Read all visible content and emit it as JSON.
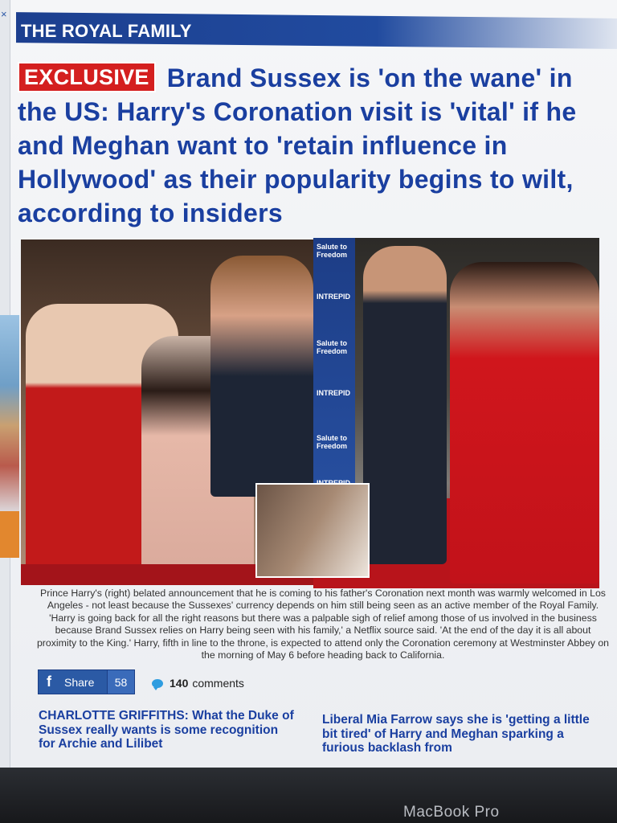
{
  "section": {
    "title": "THE ROYAL FAMILY"
  },
  "article": {
    "badge": "EXCLUSIVE",
    "headline": "Brand Sussex is 'on the wane' in the US: Harry's Coronation visit is 'vital' if he and Meghan want to 'retain influence in Hollywood' as their popularity begins to wilt, according to insiders",
    "caption": "Prince Harry's (right) belated announcement that he is coming to his father's Coronation next month was warmly welcomed in Los Angeles - not least because the Sussexes' currency depends on him still being seen as an active member of the Royal Family. 'Harry is going back for all the right reasons but there was a palpable sigh of relief among those of us involved in the business because Brand Sussex relies on Harry being seen with his family,' a Netflix source said. 'At the end of the day it is all about proximity to the King.' Harry, fifth in line to the throne, is expected to attend only the Coronation ceremony at Westminster Abbey on the morning of May 6 before heading back to California."
  },
  "photo": {
    "banner_words": [
      "Salute to Freedom",
      "INTREPID",
      "Salute to Freedom",
      "INTREPID",
      "Salute to Freedom",
      "INTREPID"
    ]
  },
  "social": {
    "share_label": "Share",
    "share_count": "58",
    "comment_count": "140",
    "comment_label": "comments"
  },
  "related": [
    {
      "title": "CHARLOTTE GRIFFITHS: What the Duke of Sussex really wants is some recognition for Archie and Lilibet"
    },
    {
      "title": "Liberal Mia Farrow says she is 'getting a little bit tired' of Harry and Meghan sparking a furious backlash from"
    }
  ],
  "device": {
    "brand": "MacBook Pro"
  },
  "colors": {
    "headline_blue": "#1a3fa0",
    "exclusive_red": "#d41f1f",
    "section_bar": "#1c3f8f",
    "facebook_blue": "#2b5aa5",
    "comment_icon": "#2f9de0"
  },
  "icons": [
    "close-icon",
    "facebook-icon",
    "comment-bubble-icon"
  ]
}
